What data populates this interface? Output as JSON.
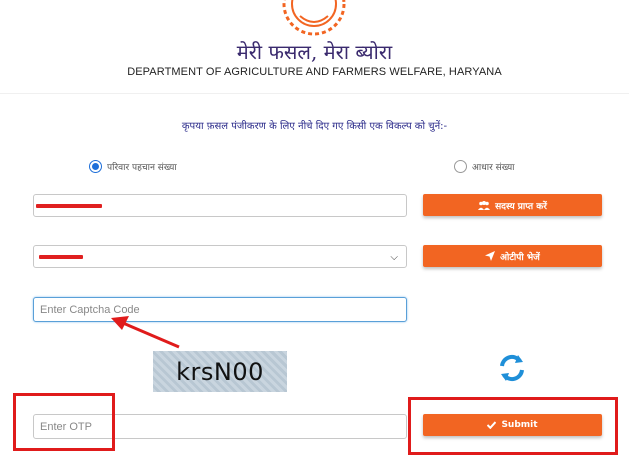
{
  "header": {
    "hindi_title": "मेरी फसल, मेरा ब्योरा",
    "department": "DEPARTMENT OF AGRICULTURE AND FARMERS WELFARE, HARYANA"
  },
  "form": {
    "instruction": "कृपया फ़सल पंजीकरण के लिए नीचे दिए गए किसी एक विकल्प को चुनें:-",
    "radio_family_id": "परिवार पहचान संख्या",
    "radio_aadhaar": "आधार संख्या",
    "selected_option": "परिवार पहचान संख्या",
    "get_members_button": "सदस्य प्राप्त करें",
    "send_otp_button": "ओटीपी भेजें",
    "captcha_placeholder": "Enter Captcha Code",
    "captcha_text": "krsN00",
    "otp_placeholder": "Enter OTP",
    "submit_button": "Submit"
  },
  "colors": {
    "accent": "#f26522",
    "radio_selected": "#1e6fd9",
    "highlight": "#e01b1b"
  },
  "icons": [
    "emblem-logo",
    "users-icon",
    "send-icon",
    "refresh-icon",
    "check-icon"
  ]
}
